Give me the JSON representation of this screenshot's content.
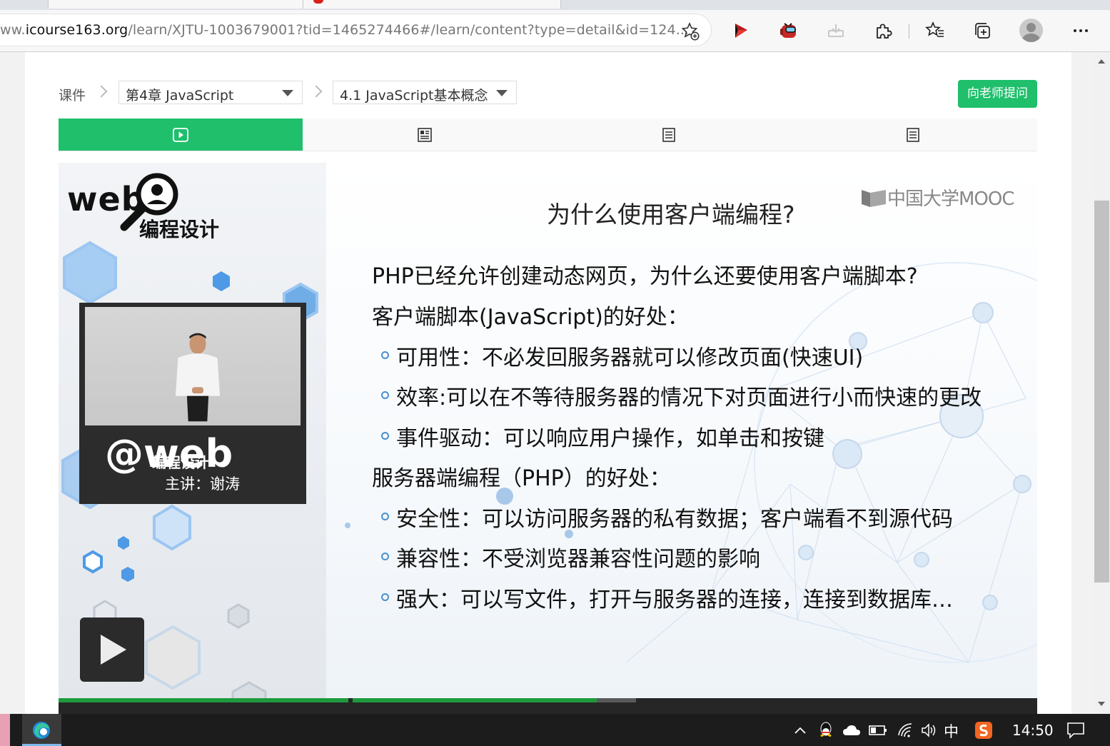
{
  "browser": {
    "url_prefix": "ww.",
    "url_host": "icourse163.org",
    "url_path": "/learn/XJTU-1003679001?tid=1465274466#/learn/content?type=detail&id=124...",
    "accent_colors": {
      "ext_red": "#d8201d",
      "edge_blue": "#1f8ad9"
    },
    "toolbar_icons": [
      "favorite-add-icon",
      "extension-red-icon",
      "extension-game-icon",
      "extension-save-icon",
      "extensions-puzzle-icon",
      "favorites-icon",
      "collections-icon",
      "profile-avatar",
      "more-menu-icon"
    ]
  },
  "course_nav": {
    "root": "课件",
    "chapter": "第4章 JavaScript",
    "section": "4.1 JavaScript基本概念",
    "ask_button": "向老师提问",
    "tabs": [
      {
        "icon": "video-play-icon",
        "active": true
      },
      {
        "icon": "document-icon",
        "active": false
      },
      {
        "icon": "notes-icon",
        "active": false
      },
      {
        "icon": "notes-icon",
        "active": false
      }
    ],
    "accent": "#1fbf6c"
  },
  "video": {
    "course_logo_top": "web",
    "course_logo_sub": "编程设计",
    "cam_brand": "@web",
    "cam_brand_sub": "编程设计",
    "speaker": "主讲：谢涛",
    "progress_played_fraction": 0.55,
    "progress_buffered_fraction": 0.59
  },
  "slide": {
    "title": "为什么使用客户端编程?",
    "watermark": "中国大学MOOC",
    "intro_question": "PHP已经允许创建动态网页，为什么还要使用客户端脚本?",
    "client_heading": "客户端脚本(JavaScript)的好处：",
    "client_points": [
      "可用性：不必发回服务器就可以修改页面(快速UI)",
      "效率:可以在不等待服务器的情况下对页面进行小而快速的更改",
      "事件驱动：可以响应用户操作，如单击和按键"
    ],
    "server_heading": "服务器端编程（PHP）的好处：",
    "server_points": [
      "安全性：可以访问服务器的私有数据；客户端看不到源代码",
      "兼容性：不受浏览器兼容性问题的影响",
      "强大：可以写文件，打开与服务器的连接，连接到数据库…"
    ]
  },
  "taskbar": {
    "ime": "中",
    "time": "14:50"
  }
}
